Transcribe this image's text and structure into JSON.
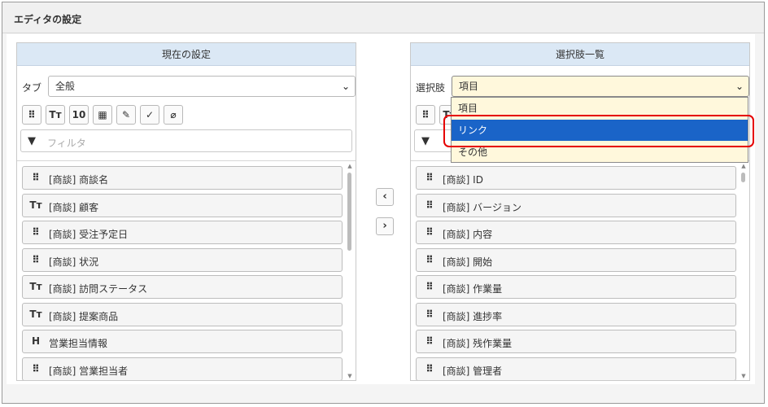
{
  "title": "エディタの設定",
  "left_panel": {
    "header": "現在の設定",
    "field_label": "タブ",
    "field_value": "全般",
    "filter_placeholder": "フィルタ",
    "items": [
      {
        "icon": "grip",
        "label": "[商談] 商談名"
      },
      {
        "icon": "text",
        "label": "[商談] 顧客"
      },
      {
        "icon": "grip",
        "label": "[商談] 受注予定日"
      },
      {
        "icon": "grip",
        "label": "[商談] 状況"
      },
      {
        "icon": "text",
        "label": "[商談] 訪問ステータス"
      },
      {
        "icon": "text",
        "label": "[商談] 提案商品"
      },
      {
        "icon": "heading",
        "label": "営業担当情報"
      },
      {
        "icon": "grip",
        "label": "[商談] 営業担当者"
      }
    ]
  },
  "right_panel": {
    "header": "選択肢一覧",
    "field_label": "選択肢",
    "field_value": "項目",
    "dropdown_options": [
      "項目",
      "リンク",
      "その他"
    ],
    "selected_option": "リンク",
    "items": [
      {
        "icon": "grip",
        "label": "[商談] ID"
      },
      {
        "icon": "grip",
        "label": "[商談] バージョン"
      },
      {
        "icon": "grip",
        "label": "[商談] 内容"
      },
      {
        "icon": "grip",
        "label": "[商談] 開始"
      },
      {
        "icon": "grip",
        "label": "[商談] 作業量"
      },
      {
        "icon": "grip",
        "label": "[商談] 進捗率"
      },
      {
        "icon": "grip",
        "label": "[商談] 残作業量"
      },
      {
        "icon": "grip",
        "label": "[商談] 管理者"
      }
    ]
  },
  "toolbar_buttons": [
    {
      "name": "item-type-grip-icon",
      "glyph": "⠿"
    },
    {
      "name": "text-type-icon",
      "glyph": "Tт"
    },
    {
      "name": "number-type-icon",
      "glyph": "10"
    },
    {
      "name": "calendar-icon",
      "glyph": "▦"
    },
    {
      "name": "note-edit-icon",
      "glyph": "✎"
    },
    {
      "name": "check-icon",
      "glyph": "✓"
    },
    {
      "name": "paperclip-icon",
      "glyph": "⌀"
    }
  ],
  "move_buttons": {
    "left": "‹",
    "right": "›"
  },
  "icons": {
    "grip": "⠿",
    "text": "Tт",
    "heading": "H",
    "filter": "▼",
    "chevron": "⌄"
  },
  "colors": {
    "header_bg": "#dbe8f5",
    "selected_bg": "#1a64c8",
    "dropdown_bg": "#fff8dc",
    "highlight": "#e60000"
  }
}
